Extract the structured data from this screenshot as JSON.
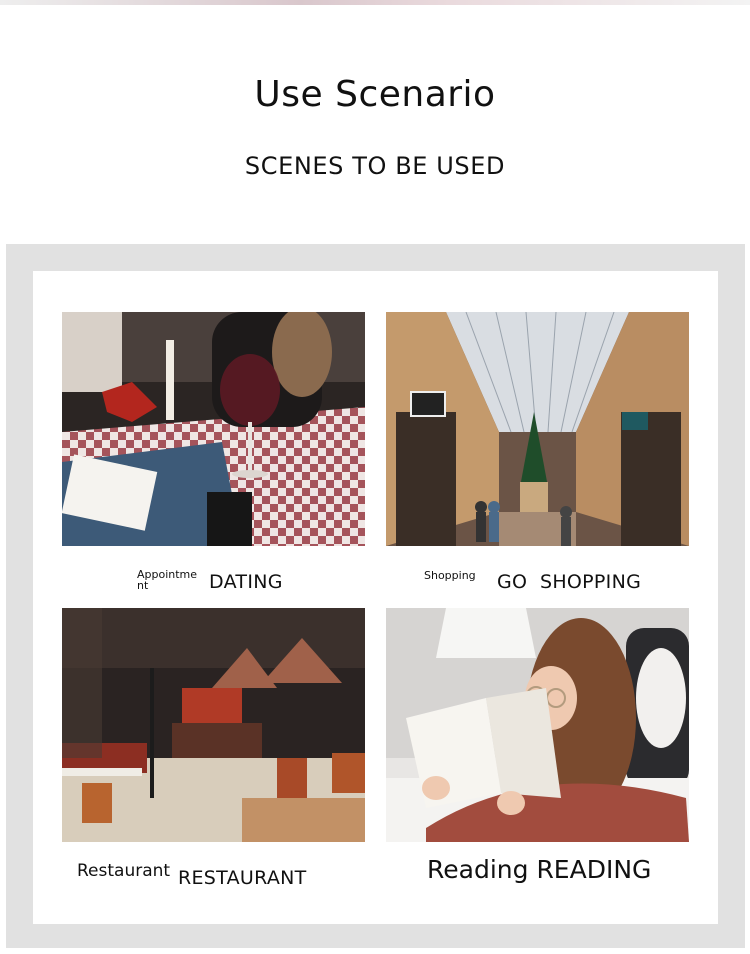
{
  "header": {
    "title": "Use Scenario",
    "subtitle": "SCENES TO BE USED"
  },
  "scenes": [
    {
      "id": "dating",
      "small_label": "Appointment",
      "label": "DATING",
      "image": "dinner-date-photo"
    },
    {
      "id": "shopping",
      "small_label": "Shopping",
      "label": "GO  SHOPPING",
      "image": "shopping-arcade-photo"
    },
    {
      "id": "restaurant",
      "small_label": "Restaurant",
      "label": "RESTAURANT",
      "image": "restaurant-interior-photo"
    },
    {
      "id": "reading",
      "small_label": "Reading",
      "label": "READING",
      "image": "woman-reading-photo"
    }
  ],
  "colors": {
    "frame": "#e1e1e1",
    "card": "#ffffff",
    "text": "#111111"
  }
}
